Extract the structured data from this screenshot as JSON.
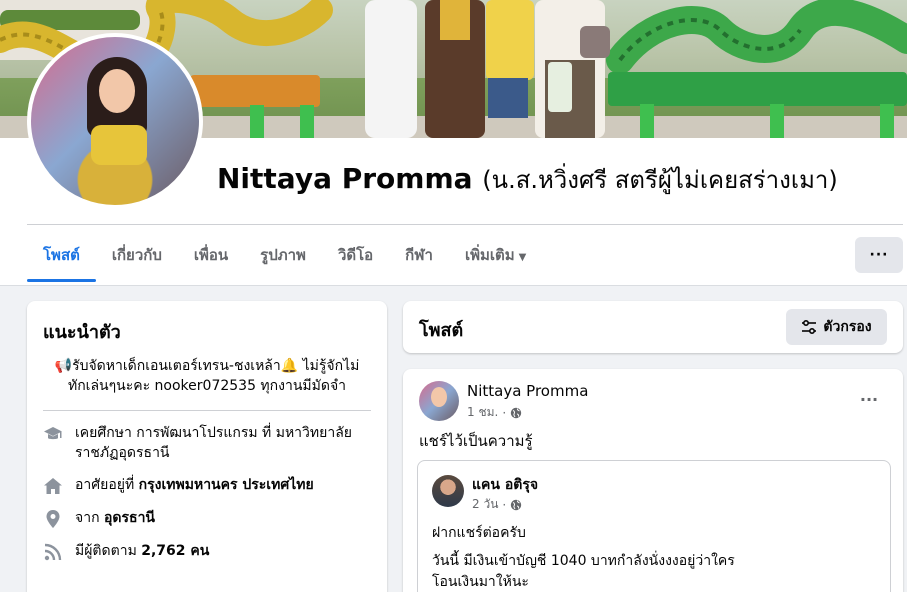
{
  "profile": {
    "name": "Nittaya Promma",
    "alternate_name": "(น.ส.หวิ่งศรี สตรีผู้ไม่เคยสร่างเมา)"
  },
  "tabs": [
    {
      "label": "โพสต์"
    },
    {
      "label": "เกี่ยวกับ"
    },
    {
      "label": "เพื่อน"
    },
    {
      "label": "รูปภาพ"
    },
    {
      "label": "วิดีโอ"
    },
    {
      "label": "กีฬา"
    },
    {
      "label": "เพิ่มเติม"
    }
  ],
  "more_button": {
    "label": "···"
  },
  "intro": {
    "title": "แนะนำตัว",
    "bio_line1": "📢รับจัดหาเด็กเอนเตอร์เทรน-ชงเหล้า🔔 ไม่รู้จักไม่",
    "bio_line2": "ทักเล่นๆนะคะ nooker072535 ทุกงานมีมัดจำ",
    "education_line1": "เคยศึกษา การพัฒนาโปรแกรม ที่ มหาวิทยาลัย",
    "education_line2": "ราชภัฏอุดรธานี",
    "lives_prefix": "อาศัยอยู่ที่ ",
    "lives_place": "กรุงเทพมหานคร ประเทศไทย",
    "from_prefix": "จาก ",
    "from_place": "อุดรธานี",
    "followers_prefix": "มีผู้ติดตาม ",
    "followers_value": "2,762 คน"
  },
  "posts_header": {
    "title": "โพสต์",
    "filter_label": "ตัวกรอง"
  },
  "post": {
    "author": "Nittaya Promma",
    "time": "1 ชม.",
    "text": "แชร์ไว้เป็นความรู้",
    "more_label": "···",
    "shared": {
      "author": "แคน อติรุจ",
      "time": "2 วัน",
      "line1": "ฝากแชร์ต่อครับ",
      "line2": "วันนี้ มีเงินเข้าบัญชี 1040 บาทกำลังนั่งงงอยู่ว่าใคร",
      "line3": "โอนเงินมาให้นะ"
    }
  },
  "colors": {
    "accent": "#1b74e4",
    "page_bg": "#f0f2f5",
    "secondary_text": "#65676b",
    "button_bg": "#e4e6eb"
  },
  "icons": [
    "graduation-cap-icon",
    "home-icon",
    "location-pin-icon",
    "rss-icon",
    "filter-sliders-icon",
    "globe-icon",
    "caret-down-icon"
  ]
}
